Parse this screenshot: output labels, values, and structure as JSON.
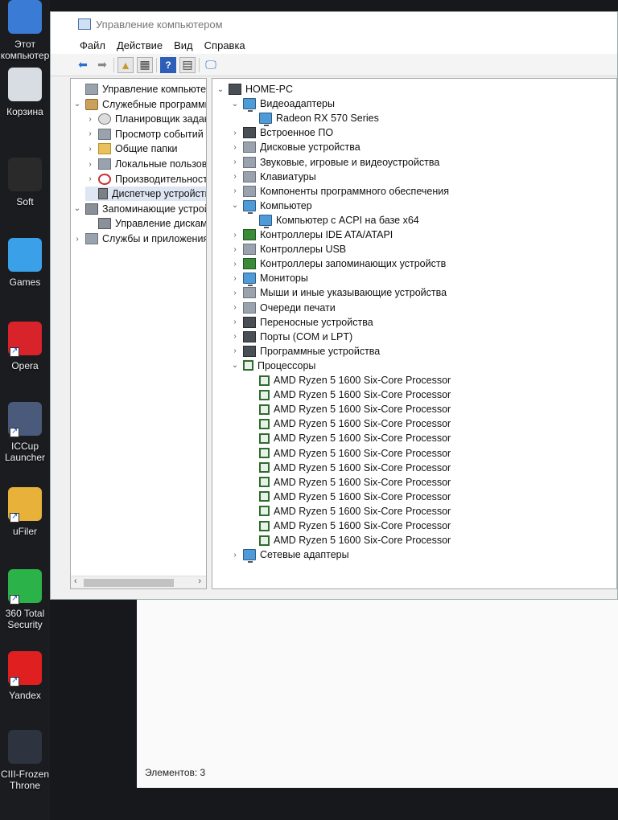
{
  "desktop": {
    "icons": [
      {
        "label": "Этот\nкомпьютер",
        "icon": "this-pc-icon",
        "color": "#3a7bd5"
      },
      {
        "label": "Корзина",
        "icon": "recycle-bin-icon",
        "color": "#d8dde3"
      },
      {
        "label": "Soft",
        "icon": "ram-chip-icon",
        "color": "#2a2a2a"
      },
      {
        "label": "Games",
        "icon": "butterfly-icon",
        "color": "#3aa0e8"
      },
      {
        "label": "Opera",
        "icon": "opera-icon",
        "color": "#d8232a"
      },
      {
        "label": "ICCup\nLauncher",
        "icon": "iccup-icon",
        "color": "#4a5a7a"
      },
      {
        "label": "uFiler",
        "icon": "ufiler-icon",
        "color": "#e8b23a"
      },
      {
        "label": "360 Total\nSecurity",
        "icon": "360-security-icon",
        "color": "#2bb34a"
      },
      {
        "label": "Yandex",
        "icon": "yandex-icon",
        "color": "#e02020"
      },
      {
        "label": "CIII-Frozen\nThrone",
        "icon": "warcraft-icon",
        "color": "#2d3440"
      }
    ]
  },
  "window": {
    "title": "Управление компьютером",
    "menu": [
      "Файл",
      "Действие",
      "Вид",
      "Справка"
    ]
  },
  "left_tree": [
    {
      "label": "Управление компьютером (л",
      "icon": "computer-management-icon",
      "arrow": ""
    },
    {
      "label": "Служебные программы",
      "icon": "tools-icon",
      "arrow": "⌄"
    },
    {
      "label": "Планировщик заданий",
      "icon": "task-scheduler-icon",
      "arrow": "›"
    },
    {
      "label": "Просмотр событий",
      "icon": "event-viewer-icon",
      "arrow": "›"
    },
    {
      "label": "Общие папки",
      "icon": "shared-folders-icon",
      "arrow": "›"
    },
    {
      "label": "Локальные пользовате",
      "icon": "local-users-icon",
      "arrow": "›"
    },
    {
      "label": "Производительность",
      "icon": "performance-icon",
      "arrow": "›"
    },
    {
      "label": "Диспетчер устройств",
      "icon": "device-manager-icon",
      "arrow": ""
    },
    {
      "label": "Запоминающие устройст",
      "icon": "storage-icon",
      "arrow": "⌄"
    },
    {
      "label": "Управление дисками",
      "icon": "disk-management-icon",
      "arrow": ""
    },
    {
      "label": "Службы и приложения",
      "icon": "services-icon",
      "arrow": "›"
    }
  ],
  "device_tree": [
    {
      "label": "HOME-PC",
      "icon": "pc-icon",
      "arrow": "⌄"
    },
    {
      "label": "Видеоадаптеры",
      "icon": "display-adapter-icon",
      "arrow": "⌄"
    },
    {
      "label": "Radeon RX 570 Series",
      "icon": "display-adapter-icon",
      "arrow": ""
    },
    {
      "label": "Встроенное ПО",
      "icon": "firmware-icon",
      "arrow": "›"
    },
    {
      "label": "Дисковые устройства",
      "icon": "disk-drive-icon",
      "arrow": "›"
    },
    {
      "label": "Звуковые, игровые и видеоустройства",
      "icon": "sound-icon",
      "arrow": "›"
    },
    {
      "label": "Клавиатуры",
      "icon": "keyboard-icon",
      "arrow": "›"
    },
    {
      "label": "Компоненты программного обеспечения",
      "icon": "software-components-icon",
      "arrow": "›"
    },
    {
      "label": "Компьютер",
      "icon": "computer-icon",
      "arrow": "⌄"
    },
    {
      "label": "Компьютер с ACPI на базе x64",
      "icon": "computer-icon",
      "arrow": ""
    },
    {
      "label": "Контроллеры IDE ATA/ATAPI",
      "icon": "ide-controller-icon",
      "arrow": "›"
    },
    {
      "label": "Контроллеры USB",
      "icon": "usb-icon",
      "arrow": "›"
    },
    {
      "label": "Контроллеры запоминающих устройств",
      "icon": "storage-controller-icon",
      "arrow": "›"
    },
    {
      "label": "Мониторы",
      "icon": "monitor-icon",
      "arrow": "›"
    },
    {
      "label": "Мыши и иные указывающие устройства",
      "icon": "mouse-icon",
      "arrow": "›"
    },
    {
      "label": "Очереди печати",
      "icon": "printer-icon",
      "arrow": "›"
    },
    {
      "label": "Переносные устройства",
      "icon": "portable-device-icon",
      "arrow": "›"
    },
    {
      "label": "Порты (COM и LPT)",
      "icon": "port-icon",
      "arrow": "›"
    },
    {
      "label": "Программные устройства",
      "icon": "software-device-icon",
      "arrow": "›"
    },
    {
      "label": "Процессоры",
      "icon": "processor-icon",
      "arrow": "⌄"
    },
    {
      "label": "AMD Ryzen 5 1600 Six-Core Processor",
      "icon": "processor-icon",
      "arrow": ""
    },
    {
      "label": "AMD Ryzen 5 1600 Six-Core Processor",
      "icon": "processor-icon",
      "arrow": ""
    },
    {
      "label": "AMD Ryzen 5 1600 Six-Core Processor",
      "icon": "processor-icon",
      "arrow": ""
    },
    {
      "label": "AMD Ryzen 5 1600 Six-Core Processor",
      "icon": "processor-icon",
      "arrow": ""
    },
    {
      "label": "AMD Ryzen 5 1600 Six-Core Processor",
      "icon": "processor-icon",
      "arrow": ""
    },
    {
      "label": "AMD Ryzen 5 1600 Six-Core Processor",
      "icon": "processor-icon",
      "arrow": ""
    },
    {
      "label": "AMD Ryzen 5 1600 Six-Core Processor",
      "icon": "processor-icon",
      "arrow": ""
    },
    {
      "label": "AMD Ryzen 5 1600 Six-Core Processor",
      "icon": "processor-icon",
      "arrow": ""
    },
    {
      "label": "AMD Ryzen 5 1600 Six-Core Processor",
      "icon": "processor-icon",
      "arrow": ""
    },
    {
      "label": "AMD Ryzen 5 1600 Six-Core Processor",
      "icon": "processor-icon",
      "arrow": ""
    },
    {
      "label": "AMD Ryzen 5 1600 Six-Core Processor",
      "icon": "processor-icon",
      "arrow": ""
    },
    {
      "label": "AMD Ryzen 5 1600 Six-Core Processor",
      "icon": "processor-icon",
      "arrow": ""
    },
    {
      "label": "Сетевые адаптеры",
      "icon": "network-adapter-icon",
      "arrow": "›"
    }
  ],
  "status_bar": {
    "text": "Элементов: 3"
  }
}
